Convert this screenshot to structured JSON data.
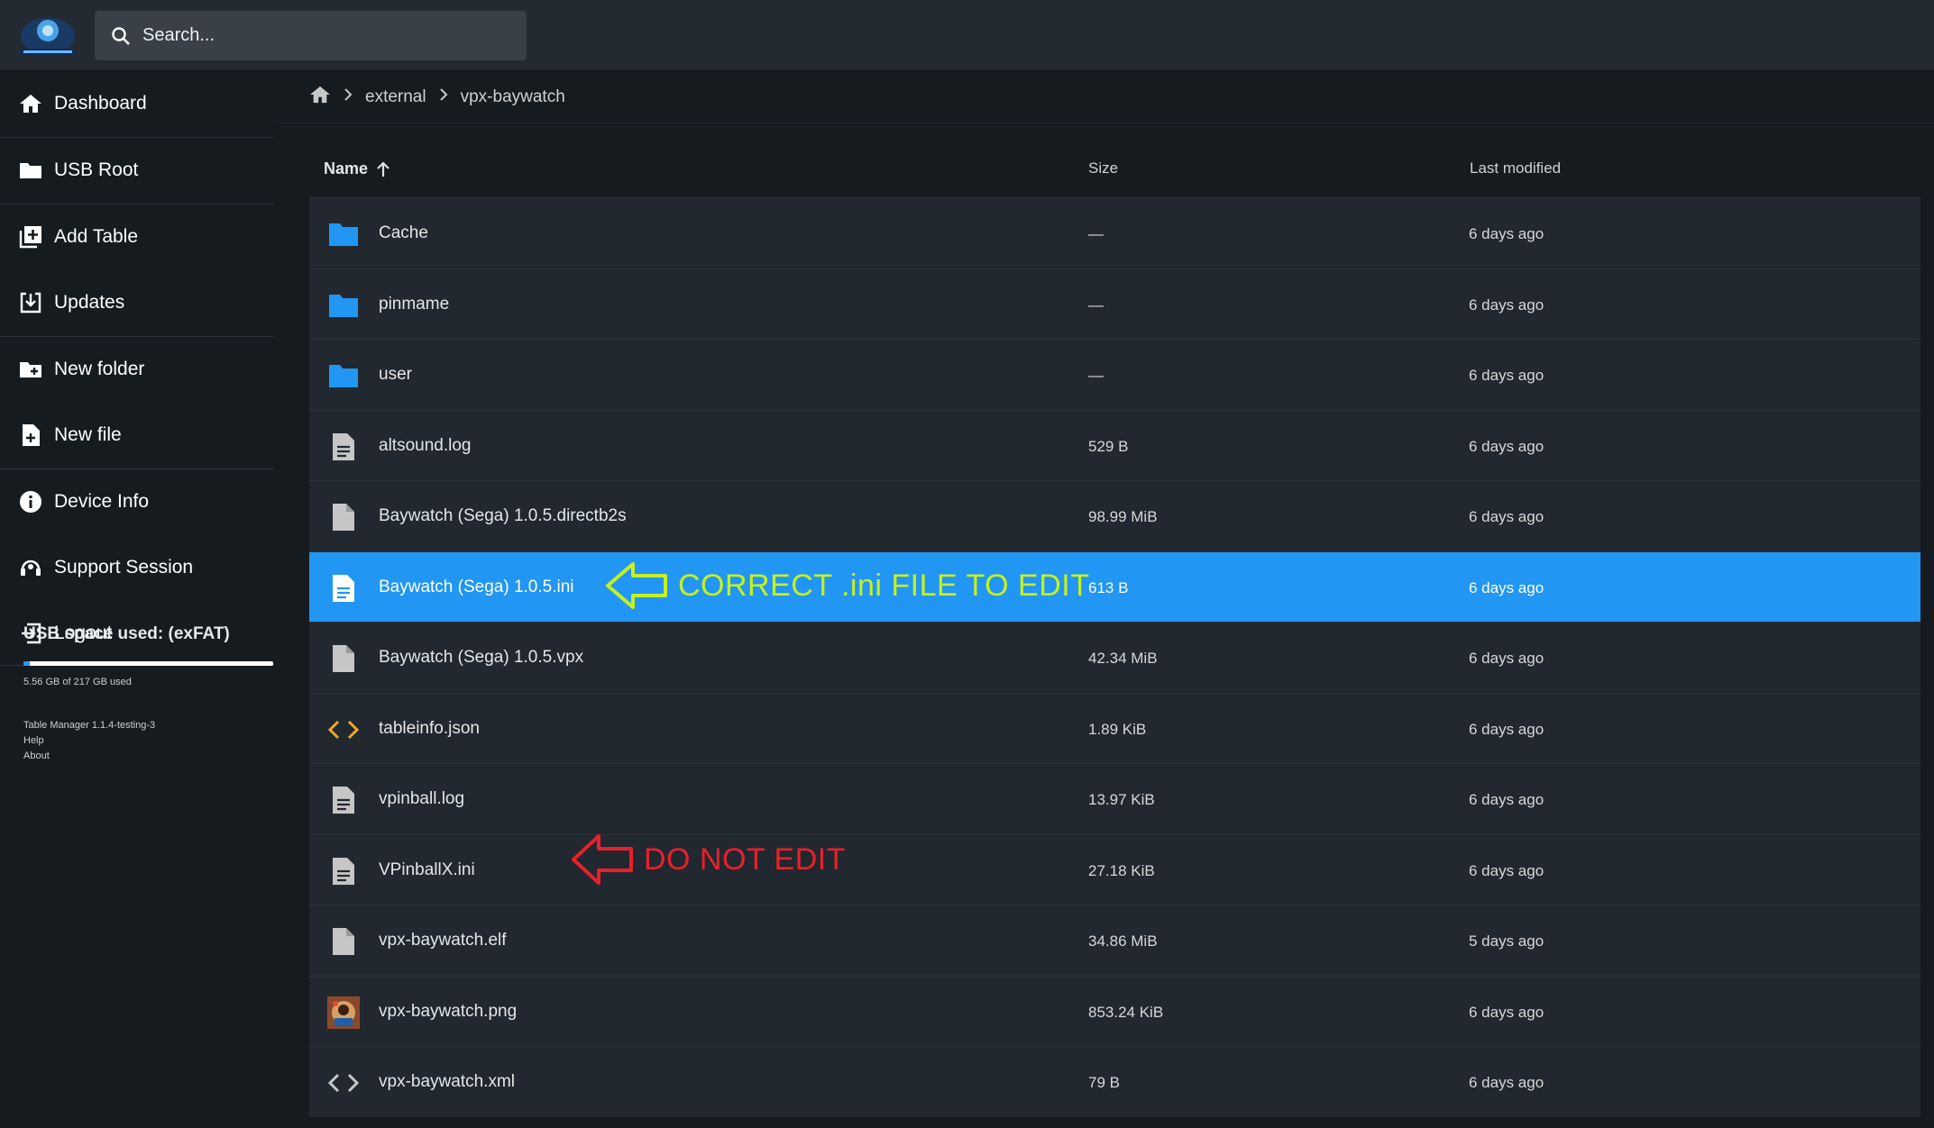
{
  "header": {
    "logo_icon": "table-manager-logo-icon",
    "search_placeholder": "Search..."
  },
  "sidebar": {
    "items": [
      {
        "label": "Dashboard",
        "icon": "home-icon"
      },
      {
        "label": "USB Root",
        "icon": "folder-icon"
      },
      {
        "label": "Add Table",
        "icon": "add-library-icon"
      },
      {
        "label": "Updates",
        "icon": "download-icon"
      },
      {
        "label": "New folder",
        "icon": "folder-plus-icon"
      },
      {
        "label": "New file",
        "icon": "file-plus-icon"
      },
      {
        "label": "Device Info",
        "icon": "info-icon"
      },
      {
        "label": "Support Session",
        "icon": "support-icon"
      },
      {
        "label": "Logout",
        "icon": "logout-icon"
      }
    ],
    "usage": {
      "title": "USB space used: (exFAT)",
      "used_text": "5.56 GB of 217 GB used",
      "used_fraction": 0.0256
    },
    "footer": {
      "version": "Table Manager 1.1.4-testing-3",
      "help": "Help",
      "about": "About"
    }
  },
  "breadcrumb": {
    "home_icon": "home-icon",
    "items": [
      "external",
      "vpx-baywatch"
    ]
  },
  "table": {
    "columns": {
      "name": "Name",
      "size": "Size",
      "modified": "Last modified"
    },
    "sort_icon": "arrow-up-icon",
    "rows": [
      {
        "name": "Cache",
        "size": "—",
        "modified": "6 days ago",
        "type": "folder"
      },
      {
        "name": "pinmame",
        "size": "—",
        "modified": "6 days ago",
        "type": "folder"
      },
      {
        "name": "user",
        "size": "—",
        "modified": "6 days ago",
        "type": "folder"
      },
      {
        "name": "altsound.log",
        "size": "529 B",
        "modified": "6 days ago",
        "type": "text"
      },
      {
        "name": "Baywatch (Sega) 1.0.5.directb2s",
        "size": "98.99 MiB",
        "modified": "6 days ago",
        "type": "file"
      },
      {
        "name": "Baywatch (Sega) 1.0.5.ini",
        "size": "613 B",
        "modified": "6 days ago",
        "type": "text",
        "selected": true
      },
      {
        "name": "Baywatch (Sega) 1.0.5.vpx",
        "size": "42.34 MiB",
        "modified": "6 days ago",
        "type": "file"
      },
      {
        "name": "tableinfo.json",
        "size": "1.89 KiB",
        "modified": "6 days ago",
        "type": "code-orange"
      },
      {
        "name": "vpinball.log",
        "size": "13.97 KiB",
        "modified": "6 days ago",
        "type": "text"
      },
      {
        "name": "VPinballX.ini",
        "size": "27.18 KiB",
        "modified": "6 days ago",
        "type": "text"
      },
      {
        "name": "vpx-baywatch.elf",
        "size": "34.86 MiB",
        "modified": "5 days ago",
        "type": "file"
      },
      {
        "name": "vpx-baywatch.png",
        "size": "853.24 KiB",
        "modified": "6 days ago",
        "type": "image"
      },
      {
        "name": "vpx-baywatch.xml",
        "size": "79 B",
        "modified": "6 days ago",
        "type": "code"
      }
    ]
  },
  "annotations": {
    "correct": {
      "text": "CORRECT .ini FILE TO EDIT",
      "color": "#c6f01e"
    },
    "donot": {
      "text": "DO NOT EDIT",
      "color": "#e8202a"
    }
  },
  "colors": {
    "accent": "#2196f3",
    "folder": "#2196f3",
    "code_orange": "#f5a623"
  }
}
